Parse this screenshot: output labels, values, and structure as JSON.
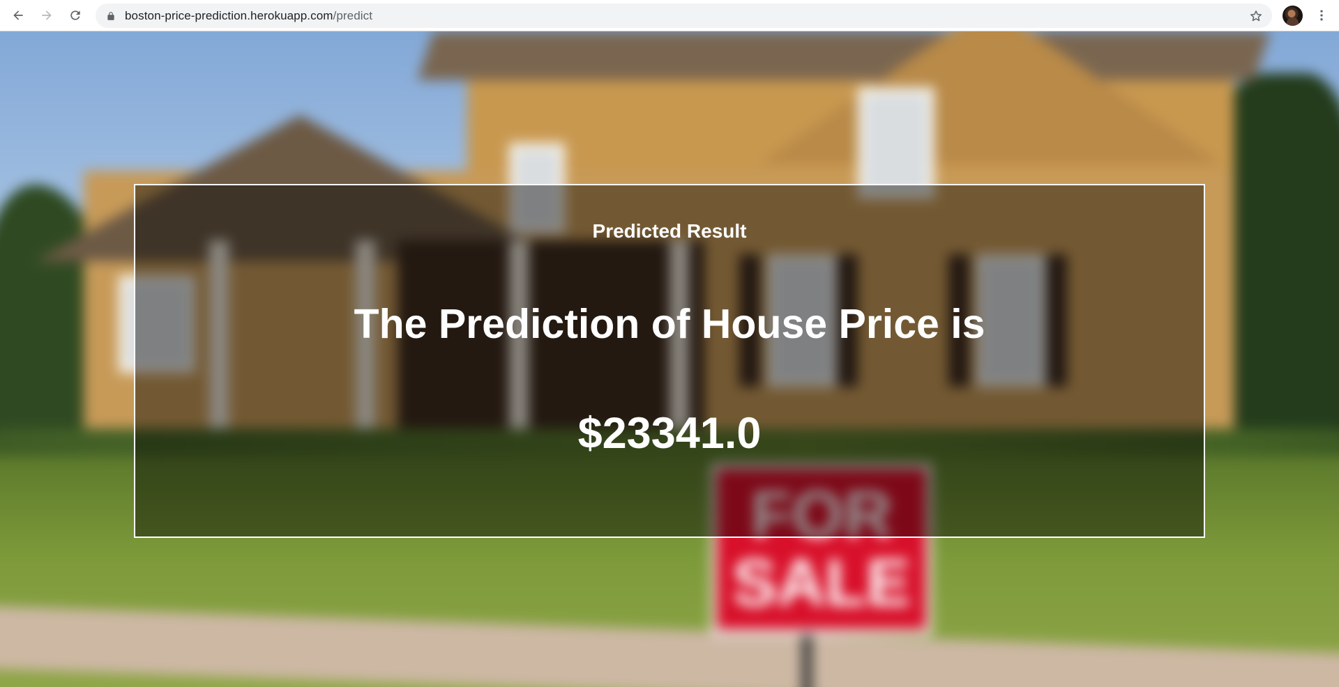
{
  "browser": {
    "url_host": "boston-price-prediction.herokuapp.com",
    "url_path": "/predict",
    "icons": {
      "back": "arrow-left-icon",
      "forward": "arrow-right-icon",
      "reload": "reload-icon",
      "lock": "lock-icon",
      "bookmark": "star-icon",
      "profile": "avatar",
      "menu": "kebab-menu-icon"
    }
  },
  "background": {
    "sign_line1": "FOR",
    "sign_line2": "SALE"
  },
  "result": {
    "heading": "Predicted Result",
    "sentence": "The Prediction of House Price is",
    "value": "$23341.0"
  },
  "colors": {
    "panel_border": "#ffffff",
    "panel_text": "#ffffff",
    "sign_red": "#d8102a"
  }
}
